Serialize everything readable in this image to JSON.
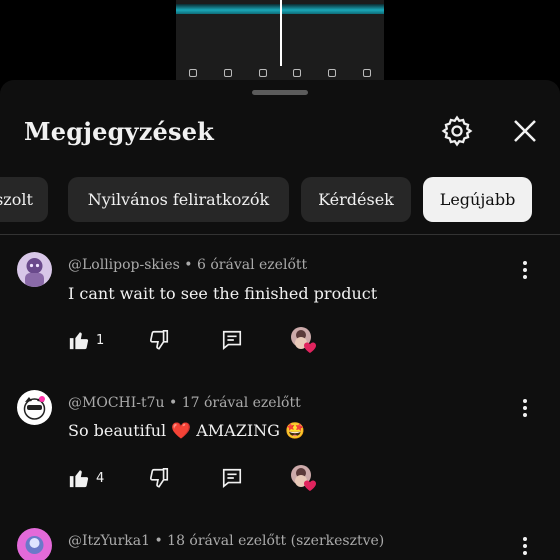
{
  "sheet": {
    "title": "Megjegyzések"
  },
  "chips": [
    {
      "label": "szolt"
    },
    {
      "label": "Nyilvános feliratkozók"
    },
    {
      "label": "Kérdések"
    },
    {
      "label": "Legújabb"
    }
  ],
  "comments": [
    {
      "author_line": "@Lollipop-skies • 6 órával ezelőtt",
      "text": "I cant wait to see the finished product",
      "likes": "1"
    },
    {
      "author_line": "@MOCHI-t7u • 17 órával ezelőtt",
      "text_before": "So beautiful ",
      "text_heart": "❤️",
      "text_mid": " AMAZING ",
      "text_emoji": "🤩",
      "likes": "4"
    },
    {
      "author_line": "@ItzYurka1 • 18 órával ezelőtt (szerkesztve)"
    }
  ],
  "colors": {
    "background": "#0f0f0f",
    "chip": "#272727",
    "chip_active": "#f1f1f1",
    "meta_text": "#aaaaaa",
    "heart": "#e0245e"
  }
}
